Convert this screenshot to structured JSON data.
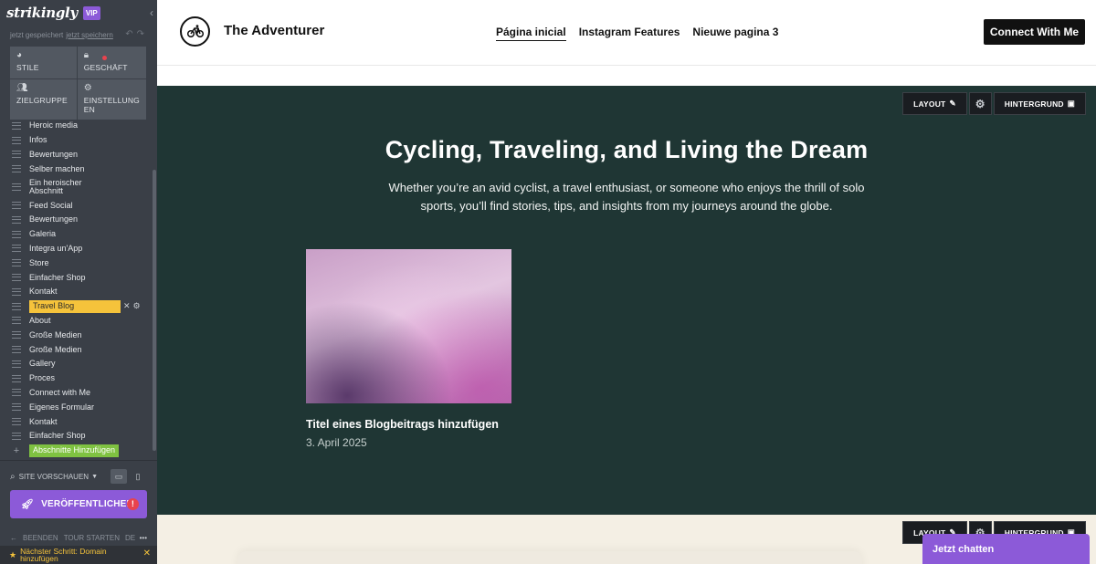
{
  "editor": {
    "brand": "strikingly",
    "vip_badge": "VIP",
    "save_status": "jetzt gespeichert",
    "save_link": "jetzt speichern",
    "panels": [
      {
        "label": "STILE",
        "icon": "palette-icon"
      },
      {
        "label": "GESCHÄFT",
        "icon": "bag-icon"
      },
      {
        "label": "ZIELGRUPPE",
        "icon": "people-icon"
      },
      {
        "label": "EINSTELLUNG EN",
        "icon": "gear-icon"
      }
    ],
    "sections": [
      "Heroic media",
      "Infos",
      "Bewertungen",
      "Selber machen",
      "Ein heroischer Abschnitt",
      "Feed Social",
      "Bewertungen",
      "Galeria",
      "Integra un'App",
      "Store",
      "Einfacher Shop",
      "Kontakt",
      "Travel Blog",
      "About",
      "Große Medien",
      "Große Medien",
      "Gallery",
      "Proces",
      "Connect with Me",
      "Eigenes Formular",
      "Kontakt",
      "Einfacher Shop"
    ],
    "active_section": "Travel Blog",
    "add_sections": "Abschnitte Hinzufügen",
    "preview_label": "SITE VORSCHAUEN",
    "publish_label": "VERÖFFENTLICHEN",
    "footer_links": {
      "quit": "BEENDEN",
      "tour": "TOUR STARTEN",
      "lang": "DE"
    },
    "next_step": "Nächster Schritt: Domain hinzufügen"
  },
  "site": {
    "title": "The Adventurer",
    "nav": [
      "Página inicial",
      "Instagram Features",
      "Nieuwe pagina 3"
    ],
    "cta": "Connect With Me"
  },
  "section_toolbar": {
    "layout": "LAYOUT",
    "background": "HINTERGRUND"
  },
  "blog": {
    "title": "Cycling, Traveling, and Living the Dream",
    "subtitle": "Whether you’re an avid cyclist, a travel enthusiast, or someone who enjoys the thrill of solo sports, you’ll find stories, tips, and insights from my journeys around the globe.",
    "post_title": "Titel eines Blogbeitrags hinzufügen",
    "post_date": "3. April 2025"
  },
  "chat": {
    "label": "Jetzt chatten"
  },
  "colors": {
    "sidebar": "#3a3f47",
    "accent": "#8c5ad8",
    "section_bg": "#1f3634",
    "active": "#f5c33b",
    "add": "#7fc241"
  }
}
